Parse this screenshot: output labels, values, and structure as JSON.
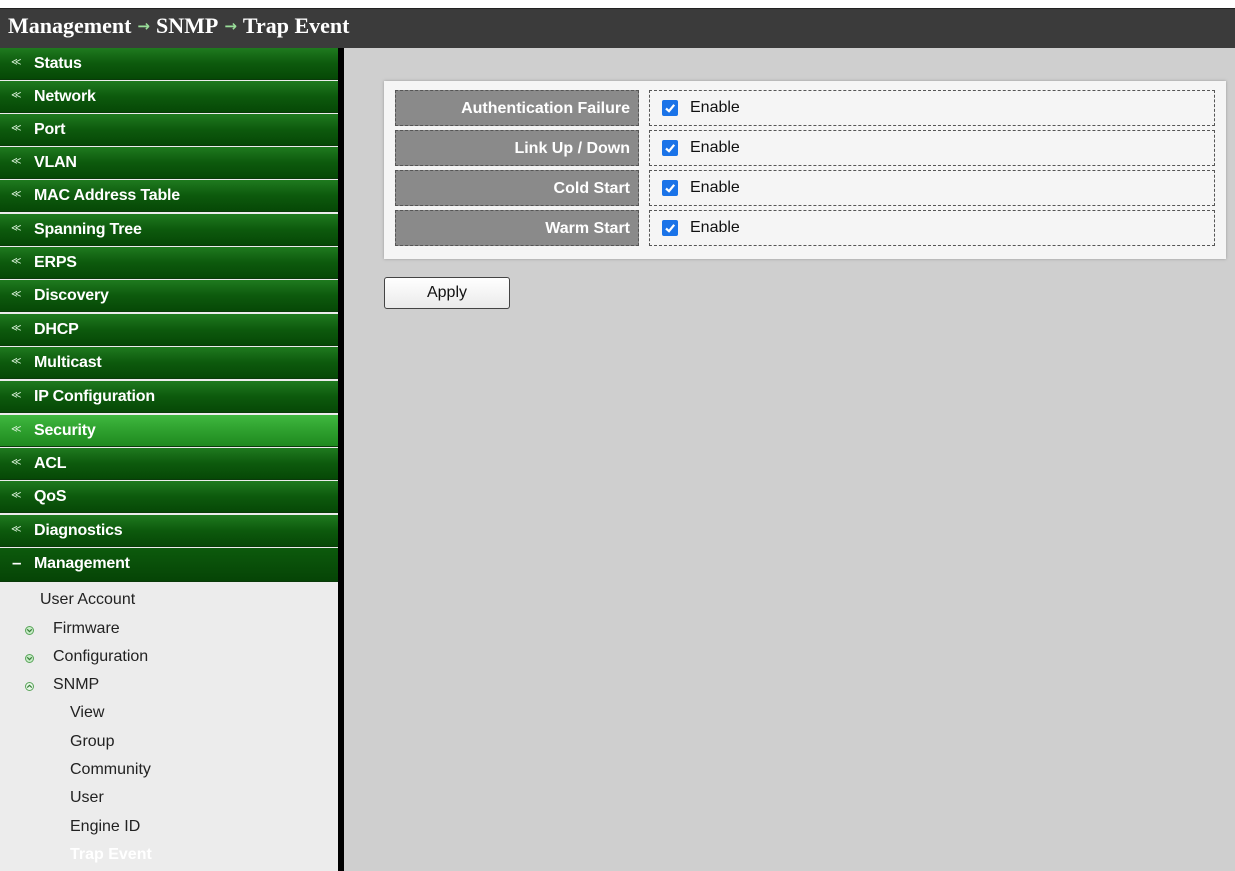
{
  "breadcrumb": {
    "parts": [
      "Management",
      "SNMP",
      "Trap Event"
    ],
    "separator": "→"
  },
  "sidebar": {
    "items": [
      {
        "label": "Status"
      },
      {
        "label": "Network"
      },
      {
        "label": "Port"
      },
      {
        "label": "VLAN"
      },
      {
        "label": "MAC Address Table"
      },
      {
        "label": "Spanning Tree"
      },
      {
        "label": "ERPS"
      },
      {
        "label": "Discovery"
      },
      {
        "label": "DHCP"
      },
      {
        "label": "Multicast"
      },
      {
        "label": "IP Configuration"
      },
      {
        "label": "Security"
      },
      {
        "label": "ACL"
      },
      {
        "label": "QoS"
      },
      {
        "label": "Diagnostics"
      },
      {
        "label": "Management"
      }
    ],
    "management_sub": [
      {
        "label": "User Account"
      },
      {
        "label": "Firmware"
      },
      {
        "label": "Configuration"
      },
      {
        "label": "SNMP"
      }
    ],
    "snmp_sub": [
      {
        "label": "View"
      },
      {
        "label": "Group"
      },
      {
        "label": "Community"
      },
      {
        "label": "User"
      },
      {
        "label": "Engine ID"
      },
      {
        "label": "Trap Event"
      }
    ]
  },
  "trap_events": [
    {
      "label": "Authentication Failure",
      "enabled": true,
      "option": "Enable"
    },
    {
      "label": "Link Up / Down",
      "enabled": true,
      "option": "Enable"
    },
    {
      "label": "Cold Start",
      "enabled": true,
      "option": "Enable"
    },
    {
      "label": "Warm Start",
      "enabled": true,
      "option": "Enable"
    }
  ],
  "apply_label": "Apply",
  "colors": {
    "menu_green": "#0d5a0d",
    "menu_active": "#2ea02e",
    "checkbox": "#1a73e8",
    "title_bar": "#3b3b3b"
  }
}
